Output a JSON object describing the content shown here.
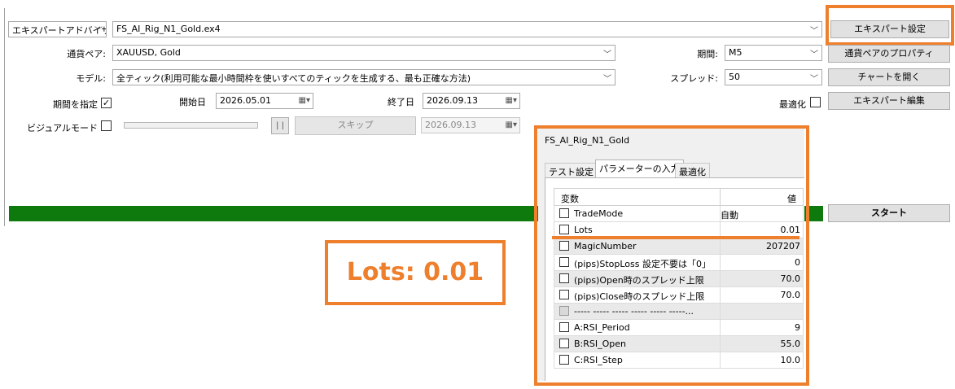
{
  "expert_selector": {
    "type_label": "エキスパートアドバイザ",
    "file": "FS_AI_Rig_N1_Gold.ex4"
  },
  "symbol": {
    "label": "通貨ペア:",
    "value": "XAUUSD, Gold"
  },
  "model": {
    "label": "モデル:",
    "value": "全ティック(利用可能な最小時間枠を使いすべてのティックを生成する、最も正確な方法)"
  },
  "period": {
    "label": "期間:",
    "value": "M5"
  },
  "spread": {
    "label": "スプレッド:",
    "value": "50"
  },
  "date_range": {
    "use_date_label": "期間を指定",
    "use_date_checked": true,
    "start_label": "開始日",
    "start_value": "2026.05.01",
    "end_label": "終了日",
    "end_value": "2026.09.13"
  },
  "optimization": {
    "label": "最適化",
    "checked": false
  },
  "visual": {
    "label": "ビジュアルモード",
    "checked": false,
    "pause_label": "| |",
    "skip_label": "スキップ",
    "skip_to_date": "2026.09.13"
  },
  "buttons": {
    "expert_properties": "エキスパート設定",
    "symbol_properties": "通貨ペアのプロパティ",
    "open_chart": "チャートを開く",
    "modify_expert": "エキスパート編集",
    "start": "スタート"
  },
  "progress": {
    "fraction": 1.0,
    "color": "#0e7a0d"
  },
  "annotation": {
    "text": "Lots: 0.01",
    "color": "#ee7f2d"
  },
  "properties_panel": {
    "title": "FS_AI_Rig_N1_Gold",
    "tabs": [
      "テスト設定",
      "パラメーターの入力",
      "最適化"
    ],
    "active_tab": 1,
    "columns": [
      "変数",
      "値"
    ],
    "rows": [
      {
        "name": "TradeMode",
        "value": "自動",
        "numeric": false,
        "shaded": false,
        "dim": false
      },
      {
        "name": "Lots",
        "value": "0.01",
        "numeric": true,
        "shaded": false,
        "dim": false
      },
      {
        "name": "MagicNumber",
        "value": "207207",
        "numeric": true,
        "shaded": true,
        "dim": false
      },
      {
        "name": "(pips)StopLoss  設定不要は「0」",
        "value": "0",
        "numeric": true,
        "shaded": false,
        "dim": false
      },
      {
        "name": "(pips)Open時のスプレッド上限",
        "value": "70.0",
        "numeric": true,
        "shaded": true,
        "dim": false
      },
      {
        "name": "(pips)Close時のスプレッド上限",
        "value": "70.0",
        "numeric": true,
        "shaded": false,
        "dim": false
      },
      {
        "name": "----- ----- ----- ----- ----- -----...",
        "value": "",
        "numeric": true,
        "shaded": true,
        "dim": true
      },
      {
        "name": "A:RSI_Period",
        "value": "9",
        "numeric": true,
        "shaded": false,
        "dim": false
      },
      {
        "name": "B:RSI_Open",
        "value": "55.0",
        "numeric": true,
        "shaded": true,
        "dim": false
      },
      {
        "name": "C:RSI_Step",
        "value": "10.0",
        "numeric": true,
        "shaded": false,
        "dim": false
      }
    ]
  }
}
